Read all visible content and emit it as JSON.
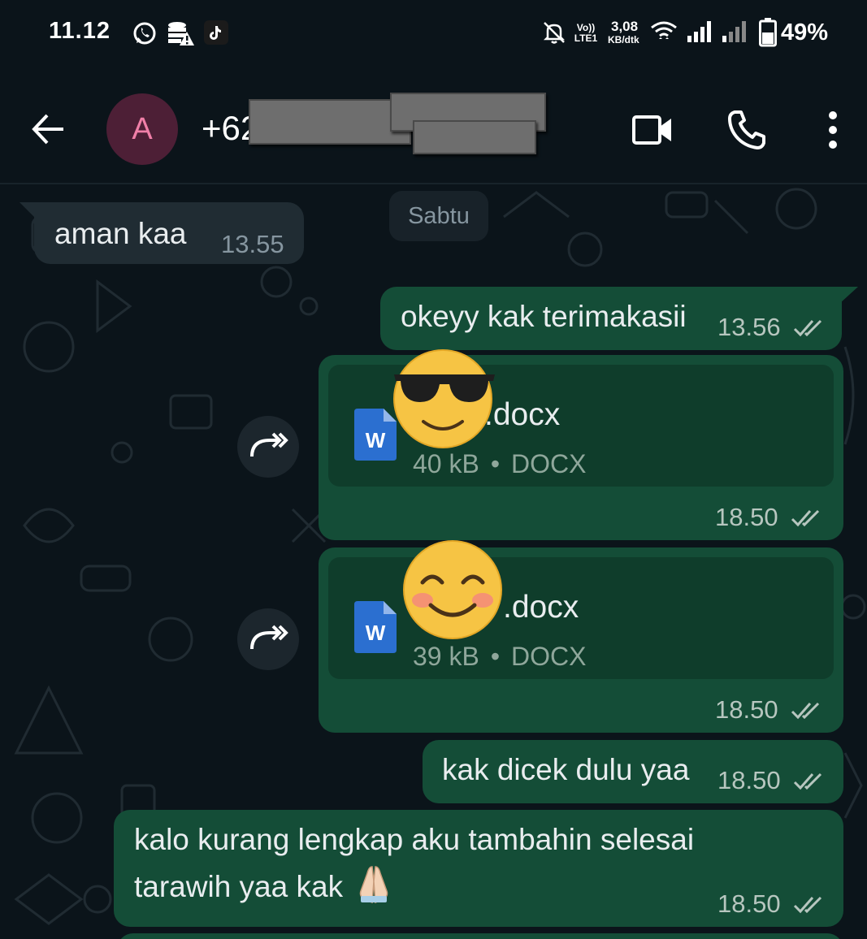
{
  "status_bar": {
    "time": "11.12",
    "network_type": "Vo)) LTE1",
    "speed_value": "3,08",
    "speed_unit": "KB/dtk",
    "battery": "49%"
  },
  "header": {
    "avatar_letter": "A",
    "contact_name": "+62"
  },
  "chat": {
    "date_chip": "Sabtu",
    "messages": [
      {
        "direction": "in",
        "text": "aman kaa",
        "time": "13.55"
      },
      {
        "direction": "out",
        "text": "okeyy kak terimakasii",
        "time": "13.56"
      },
      {
        "direction": "out",
        "type": "document",
        "file_name": ".docx",
        "file_size": "40 kB",
        "file_type": "DOCX",
        "time": "18.50"
      },
      {
        "direction": "out",
        "type": "document",
        "file_name": ".docx",
        "file_size": "39 kB",
        "file_type": "DOCX",
        "time": "18.50"
      },
      {
        "direction": "out",
        "text": "kak dicek dulu yaa",
        "time": "18.50"
      },
      {
        "direction": "out",
        "text_line1": "kalo kurang lengkap aku tambahin selesai",
        "text_line2": "tarawih yaa kak",
        "time": "18.50"
      }
    ]
  },
  "colors": {
    "background": "#0b141a",
    "incoming_bubble": "#202c33",
    "outgoing_bubble": "#144d37",
    "document_card": "#0f3d2b",
    "avatar_bg": "#4d1f36",
    "avatar_fg": "#f07fa8"
  },
  "icons": {
    "status_bar": [
      "whatsapp-icon",
      "storage-warning-icon",
      "tiktok-icon",
      "mute-icon",
      "wifi-icon",
      "signal-icon",
      "battery-icon"
    ],
    "header": [
      "back-arrow-icon",
      "video-call-icon",
      "phone-icon",
      "more-vert-icon"
    ],
    "messages": [
      "double-check-icon",
      "word-doc-icon",
      "forward-icon"
    ],
    "stickers": [
      "sunglasses-emoji",
      "smiling-blush-emoji",
      "folded-hands-emoji"
    ]
  }
}
